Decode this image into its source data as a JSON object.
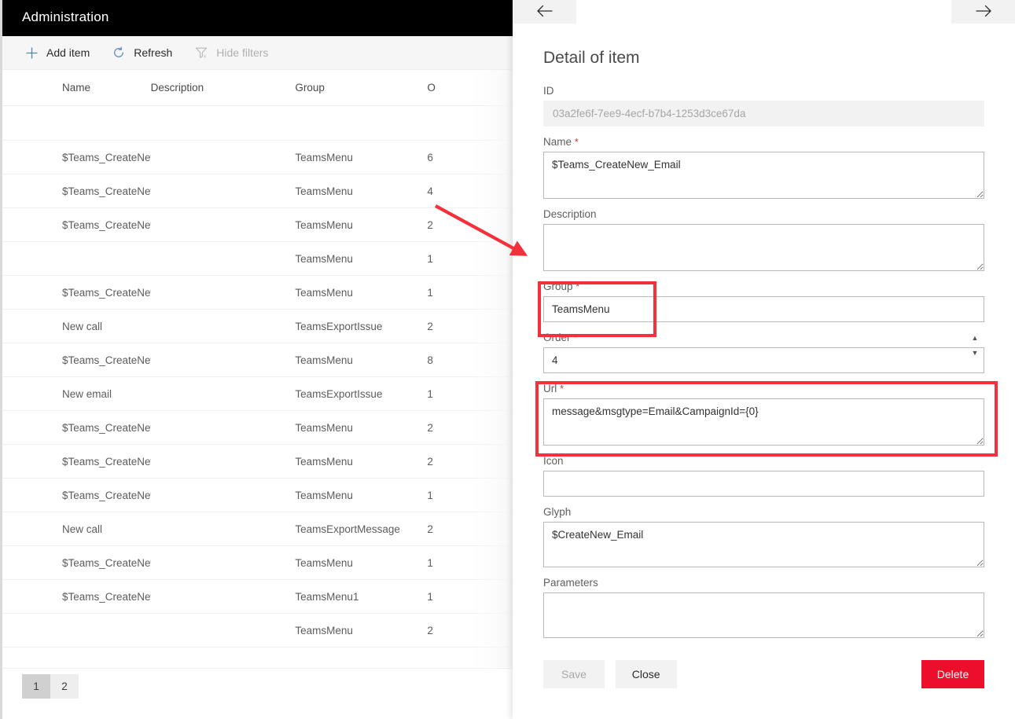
{
  "app": {
    "title": "Administration",
    "toolbar": [
      {
        "id": "add-item",
        "label": "Add item",
        "icon": "plus-icon",
        "disabled": false
      },
      {
        "id": "refresh",
        "label": "Refresh",
        "icon": "refresh-icon",
        "disabled": false
      },
      {
        "id": "hide-filters",
        "label": "Hide filters",
        "icon": "filter-off-icon",
        "disabled": true
      }
    ]
  },
  "grid": {
    "columns": [
      "Name",
      "Description",
      "Group",
      "O"
    ],
    "rows": [
      {
        "name": "",
        "description": "",
        "group": "",
        "order": ""
      },
      {
        "name": "$Teams_CreateNew_Sms",
        "description": "",
        "group": "TeamsMenu",
        "order": "6"
      },
      {
        "name": "$Teams_CreateNew_Email",
        "description": "",
        "group": "TeamsMenu",
        "order": "4"
      },
      {
        "name": "$Teams_CreateNew_ClientAlert",
        "description": "",
        "group": "TeamsMenu",
        "order": "2"
      },
      {
        "name": "",
        "description": "",
        "group": "TeamsMenu",
        "order": "1"
      },
      {
        "name": "$Teams_CreateNew_Note",
        "description": "",
        "group": "TeamsMenu",
        "order": "1"
      },
      {
        "name": "New call",
        "description": "",
        "group": "TeamsExportIssue",
        "order": "2"
      },
      {
        "name": "$Teams_CreateNew_Fax",
        "description": "",
        "group": "TeamsMenu",
        "order": "8"
      },
      {
        "name": "New email",
        "description": "",
        "group": "TeamsExportIssue",
        "order": "1"
      },
      {
        "name": "$Teams_CreateNew_KbArticle",
        "description": "",
        "group": "TeamsMenu",
        "order": "2"
      },
      {
        "name": "$Teams_CreateNew_Outboun...",
        "description": "",
        "group": "TeamsMenu",
        "order": "2"
      },
      {
        "name": "$Teams_CreateNew_Issue",
        "description": "",
        "group": "TeamsMenu",
        "order": "1"
      },
      {
        "name": "New call",
        "description": "",
        "group": "TeamsExportMessage",
        "order": "2"
      },
      {
        "name": "$Teams_CreateNew_Task",
        "description": "",
        "group": "TeamsMenu",
        "order": "1"
      },
      {
        "name": "$Teams_CreateNew_Email",
        "description": "",
        "group": "TeamsMenu1",
        "order": "1"
      },
      {
        "name": "",
        "description": "",
        "group": "TeamsMenu",
        "order": "2"
      }
    ]
  },
  "pager": {
    "pages": [
      "1",
      "2"
    ],
    "active": "1"
  },
  "panel": {
    "nav": {
      "back_icon": "arrow-left-icon",
      "forward_icon": "arrow-right-icon"
    },
    "title": "Detail of item",
    "fields": {
      "id": {
        "label": "ID",
        "value": "03a2fe6f-7ee9-4ecf-b7b4-1253d3ce67da",
        "required": false
      },
      "name": {
        "label": "Name",
        "value": "$Teams_CreateNew_Email",
        "required": true
      },
      "description": {
        "label": "Description",
        "value": "",
        "required": false
      },
      "group": {
        "label": "Group",
        "value": "TeamsMenu",
        "required": true
      },
      "order": {
        "label": "Order",
        "value": "4",
        "required": true
      },
      "url": {
        "label": "Url",
        "value": "message&msgtype=Email&CampaignId={0}",
        "required": true
      },
      "icon": {
        "label": "Icon",
        "value": "",
        "required": false
      },
      "glyph": {
        "label": "Glyph",
        "value": "$CreateNew_Email",
        "required": false
      },
      "parameters": {
        "label": "Parameters",
        "value": "",
        "required": false
      }
    },
    "buttons": {
      "save": "Save",
      "close": "Close",
      "delete": "Delete"
    }
  },
  "annotations": {
    "required_marker": "*",
    "highlight_color": "#f4303a",
    "boxes": [
      "group-field-highlight",
      "url-field-highlight"
    ],
    "arrow": "red-arrow-pointing-to-detail-panel"
  },
  "colors": {
    "header_bg": "#000000",
    "accent_blue": "#4a7ebb",
    "delete_red": "#ec0e2b",
    "required_red": "#d13438"
  }
}
